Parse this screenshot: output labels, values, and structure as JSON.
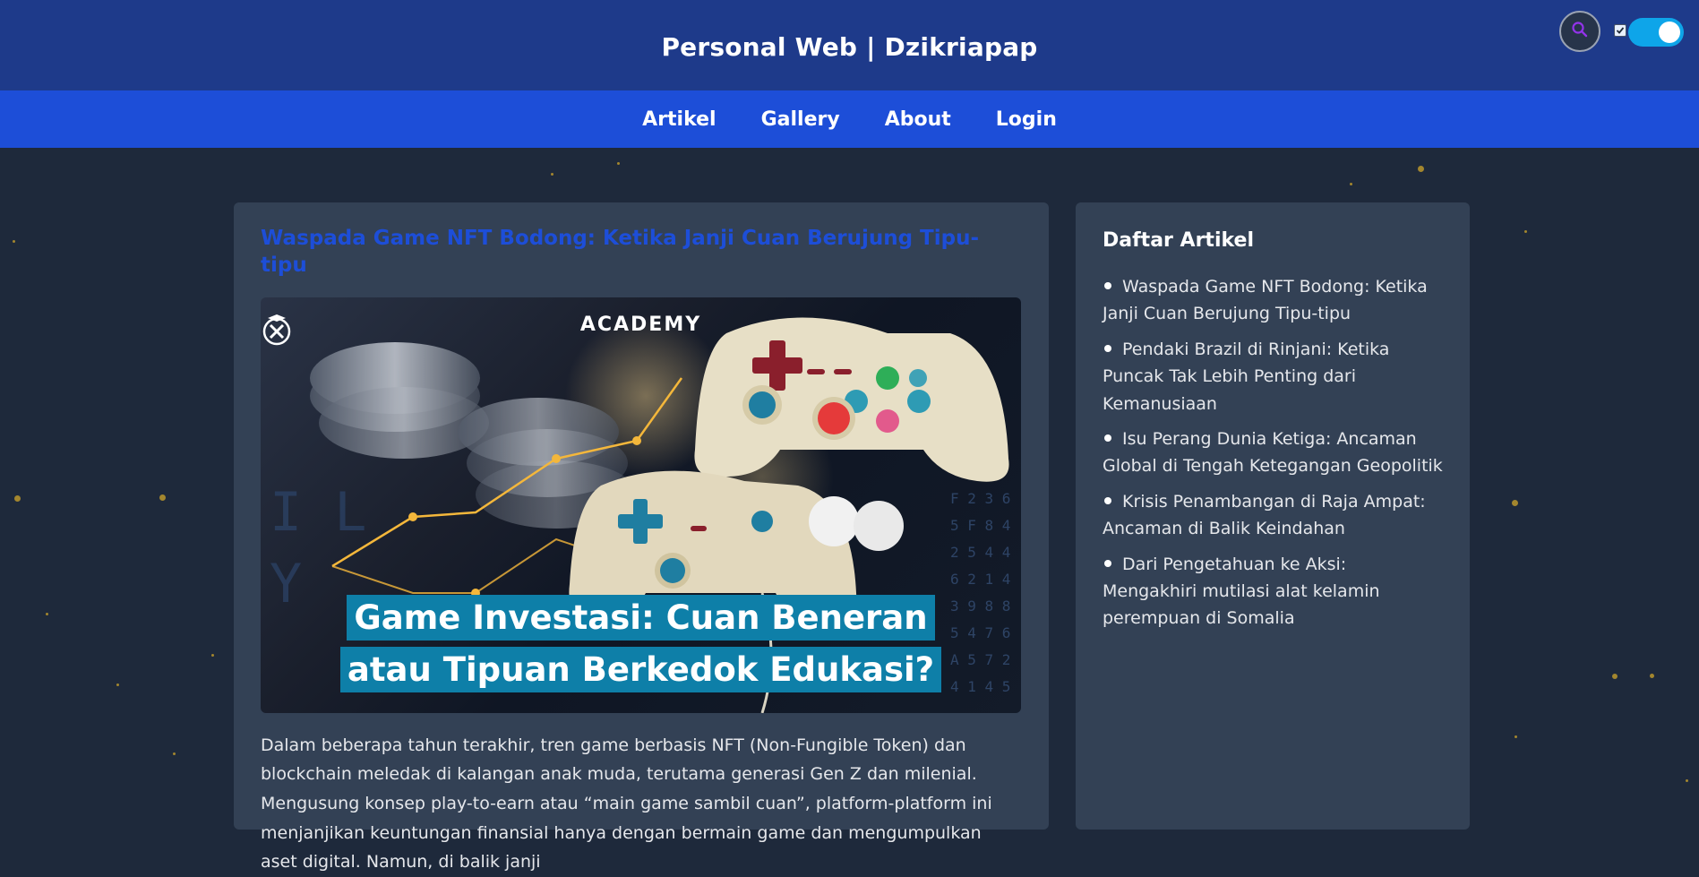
{
  "header": {
    "site_title": "Personal Web | Dzikriapap",
    "search_icon": "search-icon",
    "theme_toggle_on": true
  },
  "nav": {
    "items": [
      {
        "label": "Artikel"
      },
      {
        "label": "Gallery"
      },
      {
        "label": "About"
      },
      {
        "label": "Login"
      }
    ]
  },
  "article": {
    "title": "Waspada Game NFT Bodong: Ketika Janji Cuan Berujung Tipu-tipu",
    "image": {
      "brand": "ACADEMY",
      "caption_line1": "Game Investasi: Cuan Beneran",
      "caption_line2": "atau Tipuan Berkedok Edukasi?"
    },
    "body": "Dalam beberapa tahun terakhir, tren game berbasis NFT (Non-Fungible Token) dan blockchain meledak di kalangan anak muda, terutama generasi Gen Z dan milenial. Mengusung konsep play-to-earn atau “main game sambil cuan”, platform-platform ini menjanjikan keuntungan finansial hanya dengan bermain game dan mengumpulkan aset digital. Namun, di balik janji"
  },
  "sidebar": {
    "heading": "Daftar Artikel",
    "items": [
      {
        "label": "Waspada Game NFT Bodong: Ketika Janji Cuan Berujung Tipu-tipu"
      },
      {
        "label": "Pendaki Brazil di Rinjani: Ketika Puncak Tak Lebih Penting dari Kemanusiaan"
      },
      {
        "label": "Isu Perang Dunia Ketiga: Ancaman Global di Tengah Ketegangan Geopolitik"
      },
      {
        "label": "Krisis Penambangan di Raja Ampat: Ancaman di Balik Keindahan"
      },
      {
        "label": "Dari Pengetahuan ke Aksi: Mengakhiri mutilasi alat kelamin perempuan di Somalia"
      }
    ]
  },
  "colors": {
    "header_bg": "#1e3a8a",
    "nav_bg": "#1d4ed8",
    "page_bg": "#1e293b",
    "card_bg": "#334155",
    "title_link": "#1d4ed8",
    "toggle_on": "#0ea5e9",
    "banner_bg": "#0e7fa8"
  }
}
